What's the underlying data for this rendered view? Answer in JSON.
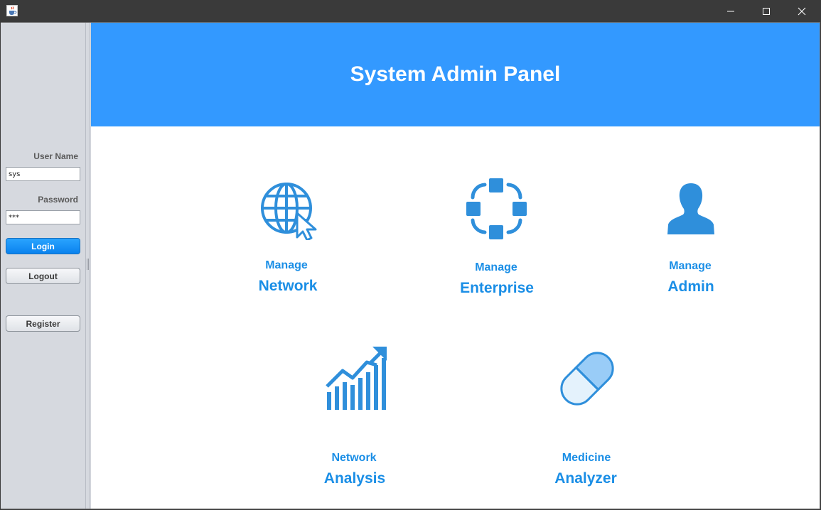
{
  "window": {
    "app_icon": "java-cup-icon",
    "controls": [
      "minimize-icon",
      "maximize-icon",
      "close-icon"
    ]
  },
  "login": {
    "username_label": "User Name",
    "username_value": "sys",
    "password_label": "Password",
    "password_value": "***",
    "login_label": "Login",
    "logout_label": "Logout",
    "register_label": "Register"
  },
  "header": {
    "title": "System Admin Panel"
  },
  "tiles": [
    {
      "line1": "Manage",
      "line2": "Network",
      "icon": "globe-cursor-icon"
    },
    {
      "line1": "Manage",
      "line2": "Enterprise",
      "icon": "network-nodes-icon"
    },
    {
      "line1": "Manage",
      "line2": "Admin",
      "icon": "user-icon"
    },
    {
      "line1": "Network",
      "line2": "Analysis",
      "icon": "growth-chart-icon"
    },
    {
      "line1": "Medicine",
      "line2": "Analyzer",
      "icon": "capsule-icon"
    }
  ],
  "colors": {
    "accent": "#3399ff",
    "tile_text": "#1a8ee6",
    "icon": "#2f8fdb"
  }
}
